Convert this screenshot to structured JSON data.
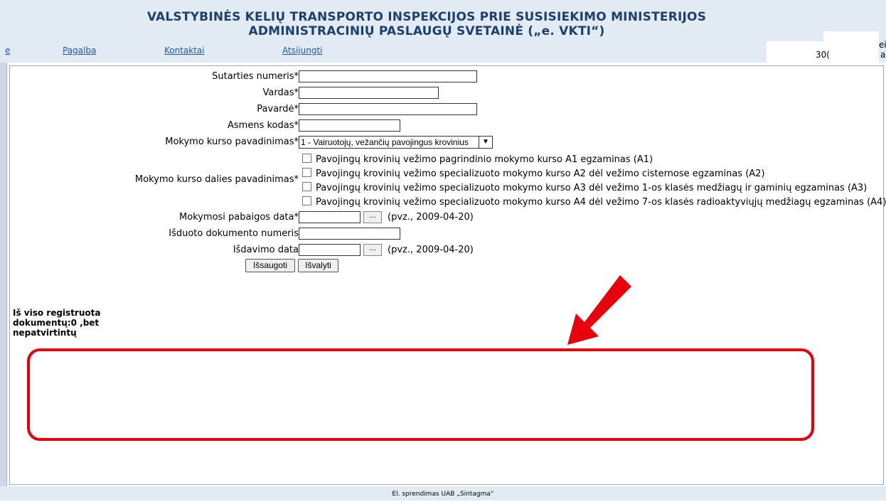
{
  "header": {
    "title_line1": "VALSTYBINĖS KELIŲ TRANSPORTO INSPEKCIJOS PRIE SUSISIEKIMO MINISTERIJOS",
    "title_line2": "ADMINISTRACINIŲ PASLAUGŲ SVETAINĖ („e. VKTI“)",
    "nav": {
      "e": "e",
      "help": "Pagalba",
      "contacts": "Kontaktai",
      "logout": "Atsijungti"
    },
    "user_code_partial": "30(",
    "edge_chars": [
      "ei",
      "a"
    ]
  },
  "form": {
    "contract_number_label": "Sutarties numeris*",
    "first_name_label": "Vardas*",
    "last_name_label": "Pavardė*",
    "personal_code_label": "Asmens kodas*",
    "course_name_label": "Mokymo kurso pavadinimas*",
    "course_name_selected": "1 - Vairuotojų, vežančių pavojingus krovinius",
    "course_part_label": "Mokymo kurso dalies pavadinimas*",
    "course_parts": [
      "Pavojingų krovinių vežimo pagrindinio mokymo kurso A1 egzaminas (A1)",
      "Pavojingų krovinių vežimo specializuoto mokymo kurso A2 dėl vežimo cisternose egzaminas (A2)",
      "Pavojingų krovinių vežimo specializuoto mokymo kurso A3 dėl vežimo 1-os klasės medžiagų ir gaminių egzaminas (A3)",
      "Pavojingų krovinių vežimo specializuoto mokymo kurso A4 dėl vežimo 7-os klasės radioaktyviųjų medžiagų egzaminas (A4)"
    ],
    "end_date_label": "Mokymosi pabaigos data*",
    "doc_number_label": "Išduoto dokumento numeris",
    "issue_date_label": "Išdavimo data",
    "date_picker_label": "...",
    "date_hint": "(pvz., 2009-04-20)",
    "save_button": "Išsaugoti",
    "clear_button": "Išvalyti",
    "values": {
      "contract_number": "",
      "first_name": "",
      "last_name": "",
      "personal_code": "",
      "end_date": "",
      "doc_number": "",
      "issue_date": ""
    }
  },
  "registered_info": "Iš viso registruota dokumentų:0 ,bet nepatvirtintų",
  "footer": {
    "text": "El. sprendimas UAB „Sintagma“"
  },
  "annotation": {
    "color": "#e8000b"
  },
  "colors": {
    "header_bg": "#e2ebf4",
    "title_color": "#1d3f6e",
    "link_color": "#1f55a8"
  }
}
